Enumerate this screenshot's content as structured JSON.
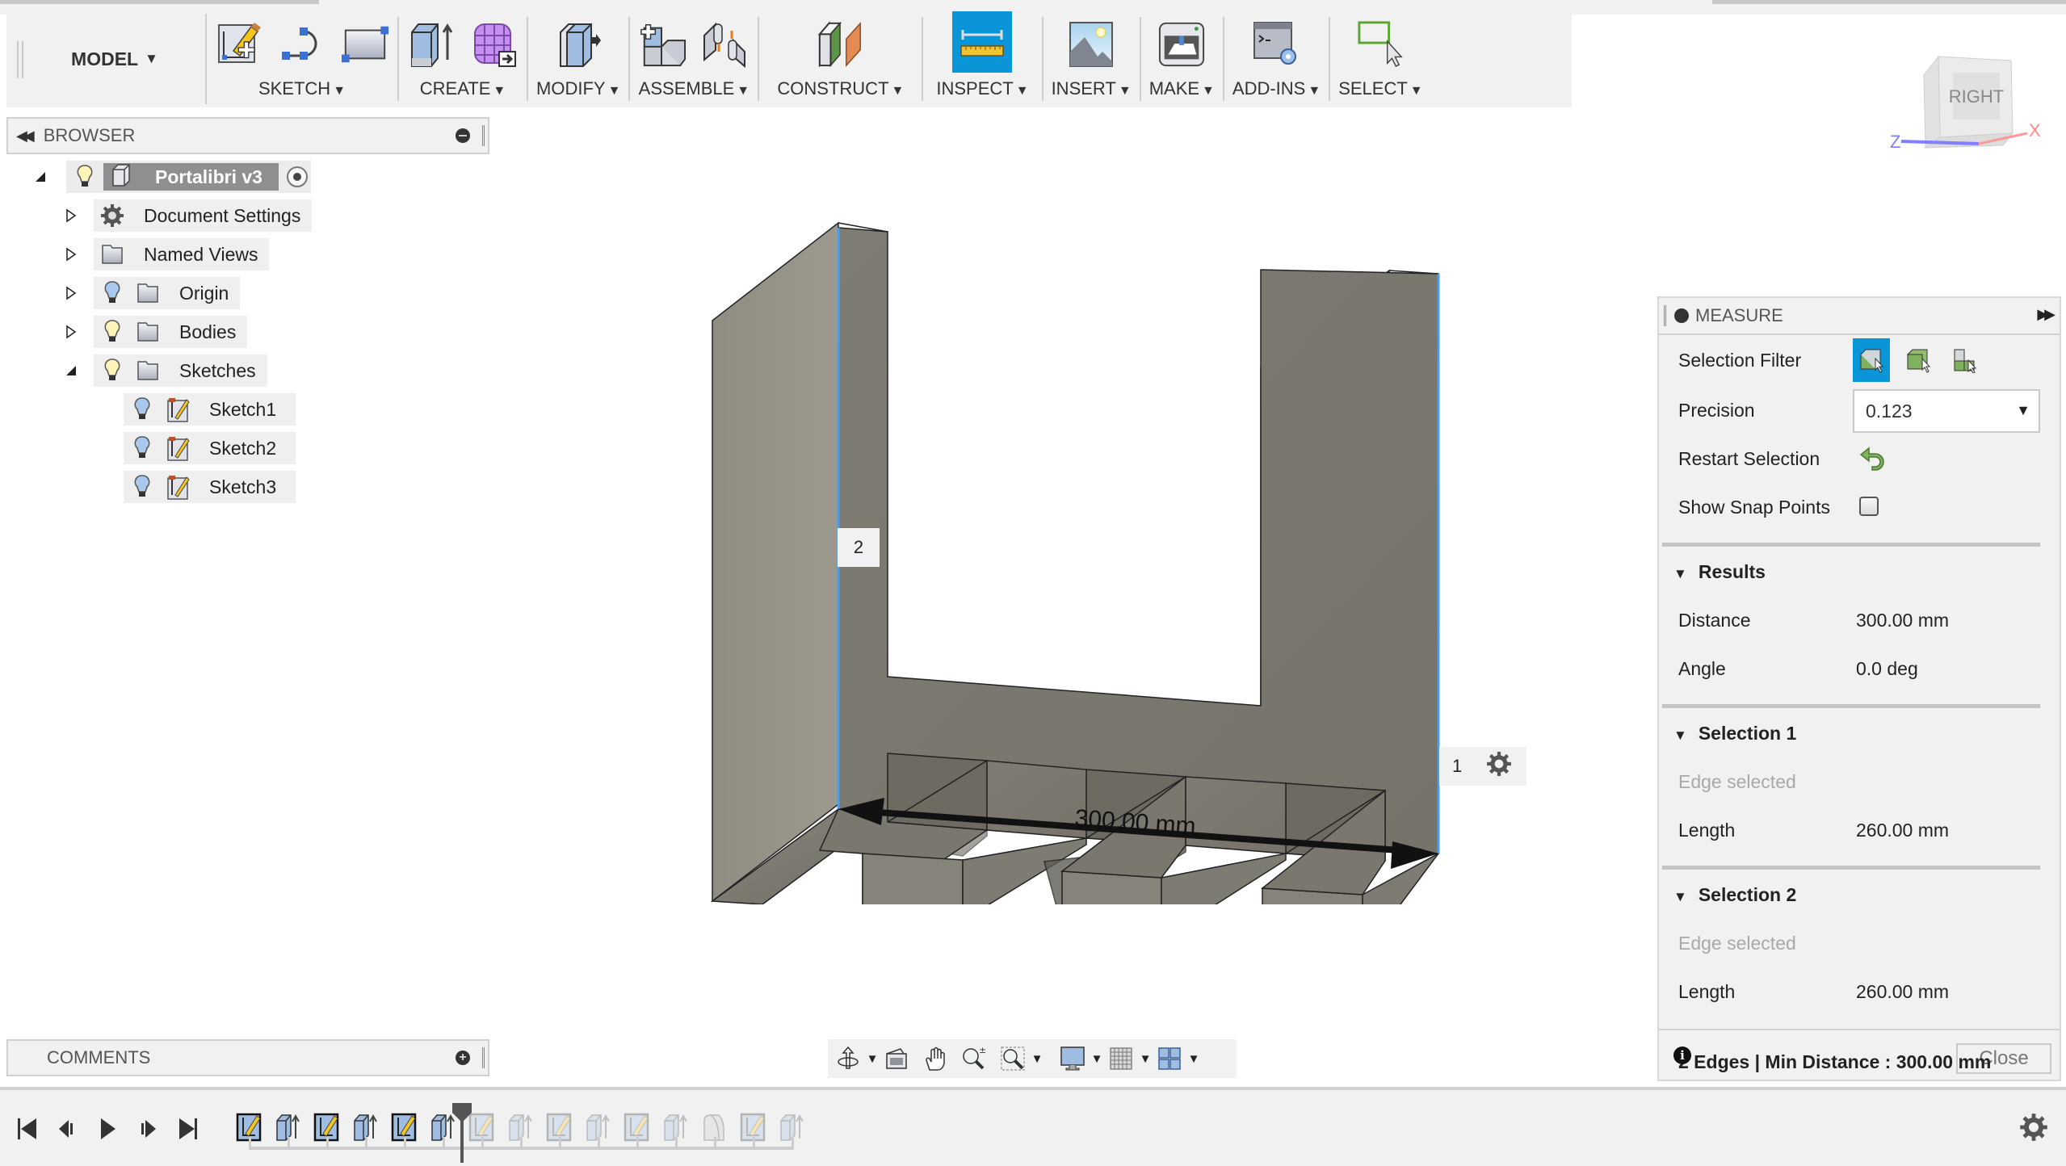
{
  "toolbar": {
    "workspace": "MODEL",
    "groups": [
      {
        "label": "SKETCH",
        "icons": [
          "create-sketch-icon",
          "arc-icon",
          "rectangle-icon"
        ]
      },
      {
        "label": "CREATE",
        "icons": [
          "extrude-icon",
          "create-form-icon"
        ]
      },
      {
        "label": "MODIFY",
        "icons": [
          "press-pull-icon"
        ]
      },
      {
        "label": "ASSEMBLE",
        "icons": [
          "new-component-icon",
          "joint-icon"
        ]
      },
      {
        "label": "CONSTRUCT",
        "icons": [
          "offset-plane-icon"
        ]
      },
      {
        "label": "INSPECT",
        "icons": [
          "measure-icon"
        ],
        "active": true
      },
      {
        "label": "INSERT",
        "icons": [
          "insert-image-icon"
        ]
      },
      {
        "label": "MAKE",
        "icons": [
          "3d-print-icon"
        ]
      },
      {
        "label": "ADD-INS",
        "icons": [
          "scripts-addins-icon"
        ]
      },
      {
        "label": "SELECT",
        "icons": [
          "select-icon"
        ]
      }
    ]
  },
  "viewcube": {
    "face": "RIGHT",
    "axis_z": "Z",
    "axis_x": "X"
  },
  "browser": {
    "title": "BROWSER",
    "root": {
      "label": "Portalibri v3"
    },
    "items": [
      {
        "label": "Document Settings",
        "icon": "gear-icon"
      },
      {
        "label": "Named Views",
        "icon": "folder-icon"
      },
      {
        "label": "Origin",
        "icon": "folder-icon",
        "visibility": "visible-blue"
      },
      {
        "label": "Bodies",
        "icon": "folder-icon",
        "visibility": "visible-yellow"
      },
      {
        "label": "Sketches",
        "icon": "folder-icon",
        "visibility": "visible-yellow",
        "expanded": true
      }
    ],
    "sketches": [
      "Sketch1",
      "Sketch2",
      "Sketch3"
    ]
  },
  "comments": {
    "title": "COMMENTS"
  },
  "viewport": {
    "dimension_label": "300.00 mm",
    "pick_label_1": "1",
    "pick_label_2": "2",
    "colors": {
      "body": "#8a877d",
      "selection_edge": "#4a9ef0",
      "accent": "#0a95d8"
    }
  },
  "measure": {
    "title": "MEASURE",
    "selection_filter_label": "Selection Filter",
    "precision_label": "Precision",
    "precision_value": "0.123",
    "restart_label": "Restart Selection",
    "snap_label": "Show Snap Points",
    "snap_checked": false,
    "results": {
      "title": "Results",
      "distance_label": "Distance",
      "distance_value": "300.00 mm",
      "angle_label": "Angle",
      "angle_value": "0.0 deg"
    },
    "selection1": {
      "title": "Selection 1",
      "status": "Edge selected",
      "length_label": "Length",
      "length_value": "260.00 mm"
    },
    "selection2": {
      "title": "Selection 2",
      "status": "Edge selected",
      "length_label": "Length",
      "length_value": "260.00 mm"
    },
    "footer": {
      "status": "2 Edges | Min Distance : 300.00 mm",
      "close_label": "Close"
    }
  },
  "timeline": {
    "features": [
      "sketch",
      "extrude",
      "sketch",
      "extrude",
      "sketch",
      "extrude",
      "sketch",
      "extrude",
      "sketch",
      "extrude",
      "sketch",
      "extrude",
      "fillet",
      "sketch",
      "extrude"
    ],
    "active_count": 6
  }
}
